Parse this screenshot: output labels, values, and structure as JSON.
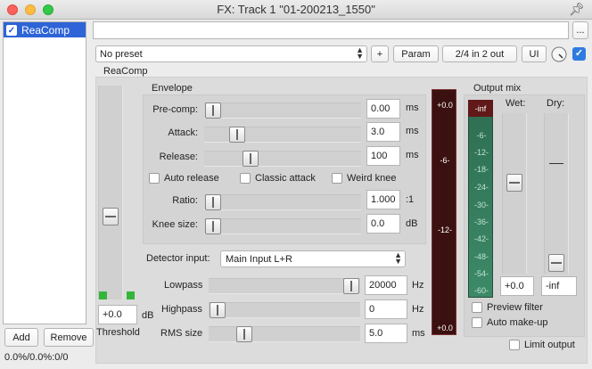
{
  "window": {
    "title": "FX: Track 1 \"01-200213_1550\"",
    "pin_icon": "pin-icon"
  },
  "fx_list": {
    "items": [
      {
        "name": "ReaComp",
        "enabled": true
      }
    ]
  },
  "buttons": {
    "add": "Add",
    "remove": "Remove",
    "more": "...",
    "plus": "+",
    "param": "Param",
    "io": "2/4 in 2 out",
    "ui": "UI"
  },
  "status": "0.0%/0.0%:0/0",
  "preset": {
    "value": "No preset"
  },
  "plugin": {
    "title": "ReaComp",
    "threshold": {
      "value": "+0.0",
      "unit": "dB",
      "label": "Threshold",
      "level": 0.37
    },
    "envelope": {
      "title": "Envelope",
      "precomp": {
        "label": "Pre-comp:",
        "value": "0.00",
        "unit": "ms",
        "level": 0.0
      },
      "attack": {
        "label": "Attack:",
        "value": "3.0",
        "unit": "ms",
        "level": 0.17
      },
      "release": {
        "label": "Release:",
        "value": "100",
        "unit": "ms",
        "level": 0.27
      },
      "auto_release": "Auto release",
      "classic_attack": "Classic attack",
      "weird_knee": "Weird knee",
      "ratio": {
        "label": "Ratio:",
        "value": "1.000",
        "unit": ":1",
        "level": 0.0
      },
      "knee": {
        "label": "Knee size:",
        "value": "0.0",
        "unit": "dB",
        "level": 0.0
      }
    },
    "detector": {
      "label": "Detector input:",
      "value": "Main Input L+R"
    },
    "lowpass": {
      "label": "Lowpass",
      "value": "20000",
      "unit": "Hz",
      "level": 1.0
    },
    "highpass": {
      "label": "Highpass",
      "value": "0",
      "unit": "Hz",
      "level": 0.0
    },
    "rms": {
      "label": "RMS size",
      "value": "5.0",
      "unit": "ms",
      "level": 0.2
    },
    "input_meter": {
      "ticks": [
        "+0.0",
        "-6-",
        "-12-",
        "+0.0"
      ]
    },
    "output_mix": {
      "title": "Output mix",
      "wet_label": "Wet:",
      "dry_label": "Dry:",
      "meter_top": "-inf",
      "meter_ticks": [
        "-6-",
        "-12-",
        "-18-",
        "-24-",
        "-30-",
        "-36-",
        "-42-",
        "-48-",
        "-54-",
        "-60-"
      ],
      "wet_value": "+0.0",
      "dry_value": "-inf",
      "wet_level": 0.57,
      "dry_level": 0.0,
      "preview_filter": "Preview filter",
      "auto_makeup": "Auto make-up",
      "limit_output": "Limit output"
    }
  }
}
